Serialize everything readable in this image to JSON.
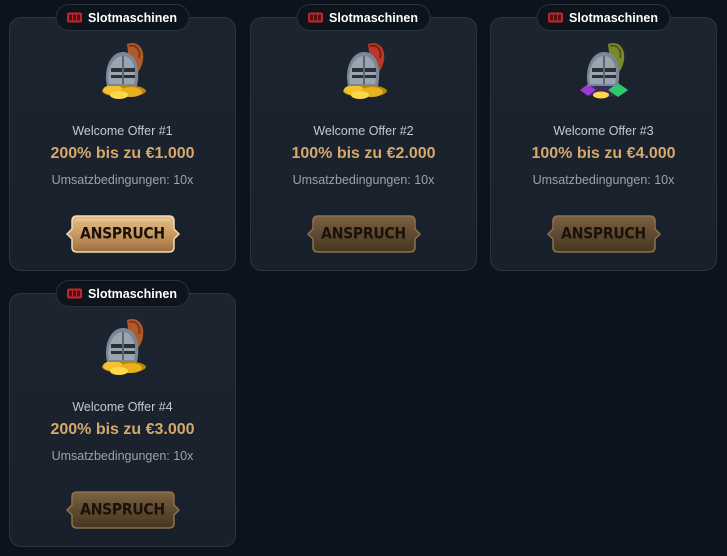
{
  "colors": {
    "background": "#0d131c",
    "card": "#1b232e",
    "amount_gold": "#d6a86a",
    "button_active": "#c89a62",
    "button_inactive": "#5e4a30"
  },
  "offers": [
    {
      "category": "Slotmaschinen",
      "category_icon": "slot-machine-icon",
      "image": "knight-helmet-coins-icon",
      "plume_color": "#b05a2a",
      "title": "Welcome Offer #1",
      "amount": "200% bis zu €1.000",
      "terms": "Umsatzbedingungen: 10x",
      "button_label": "ANSPRUCH",
      "button_state": "highlighted"
    },
    {
      "category": "Slotmaschinen",
      "category_icon": "slot-machine-icon",
      "image": "knight-helmet-coins-icon",
      "plume_color": "#b8382a",
      "title": "Welcome Offer #2",
      "amount": "100% bis zu €2.000",
      "terms": "Umsatzbedingungen: 10x",
      "button_label": "ANSPRUCH",
      "button_state": "normal"
    },
    {
      "category": "Slotmaschinen",
      "category_icon": "slot-machine-icon",
      "image": "knight-helmet-gems-icon",
      "plume_color": "#7a8a2a",
      "title": "Welcome Offer #3",
      "amount": "100% bis zu €4.000",
      "terms": "Umsatzbedingungen: 10x",
      "button_label": "ANSPRUCH",
      "button_state": "normal"
    },
    {
      "category": "Slotmaschinen",
      "category_icon": "slot-machine-icon",
      "image": "knight-helmet-coins-icon",
      "plume_color": "#b05a2a",
      "title": "Welcome Offer #4",
      "amount": "200% bis zu €3.000",
      "terms": "Umsatzbedingungen: 10x",
      "button_label": "ANSPRUCH",
      "button_state": "normal"
    }
  ]
}
